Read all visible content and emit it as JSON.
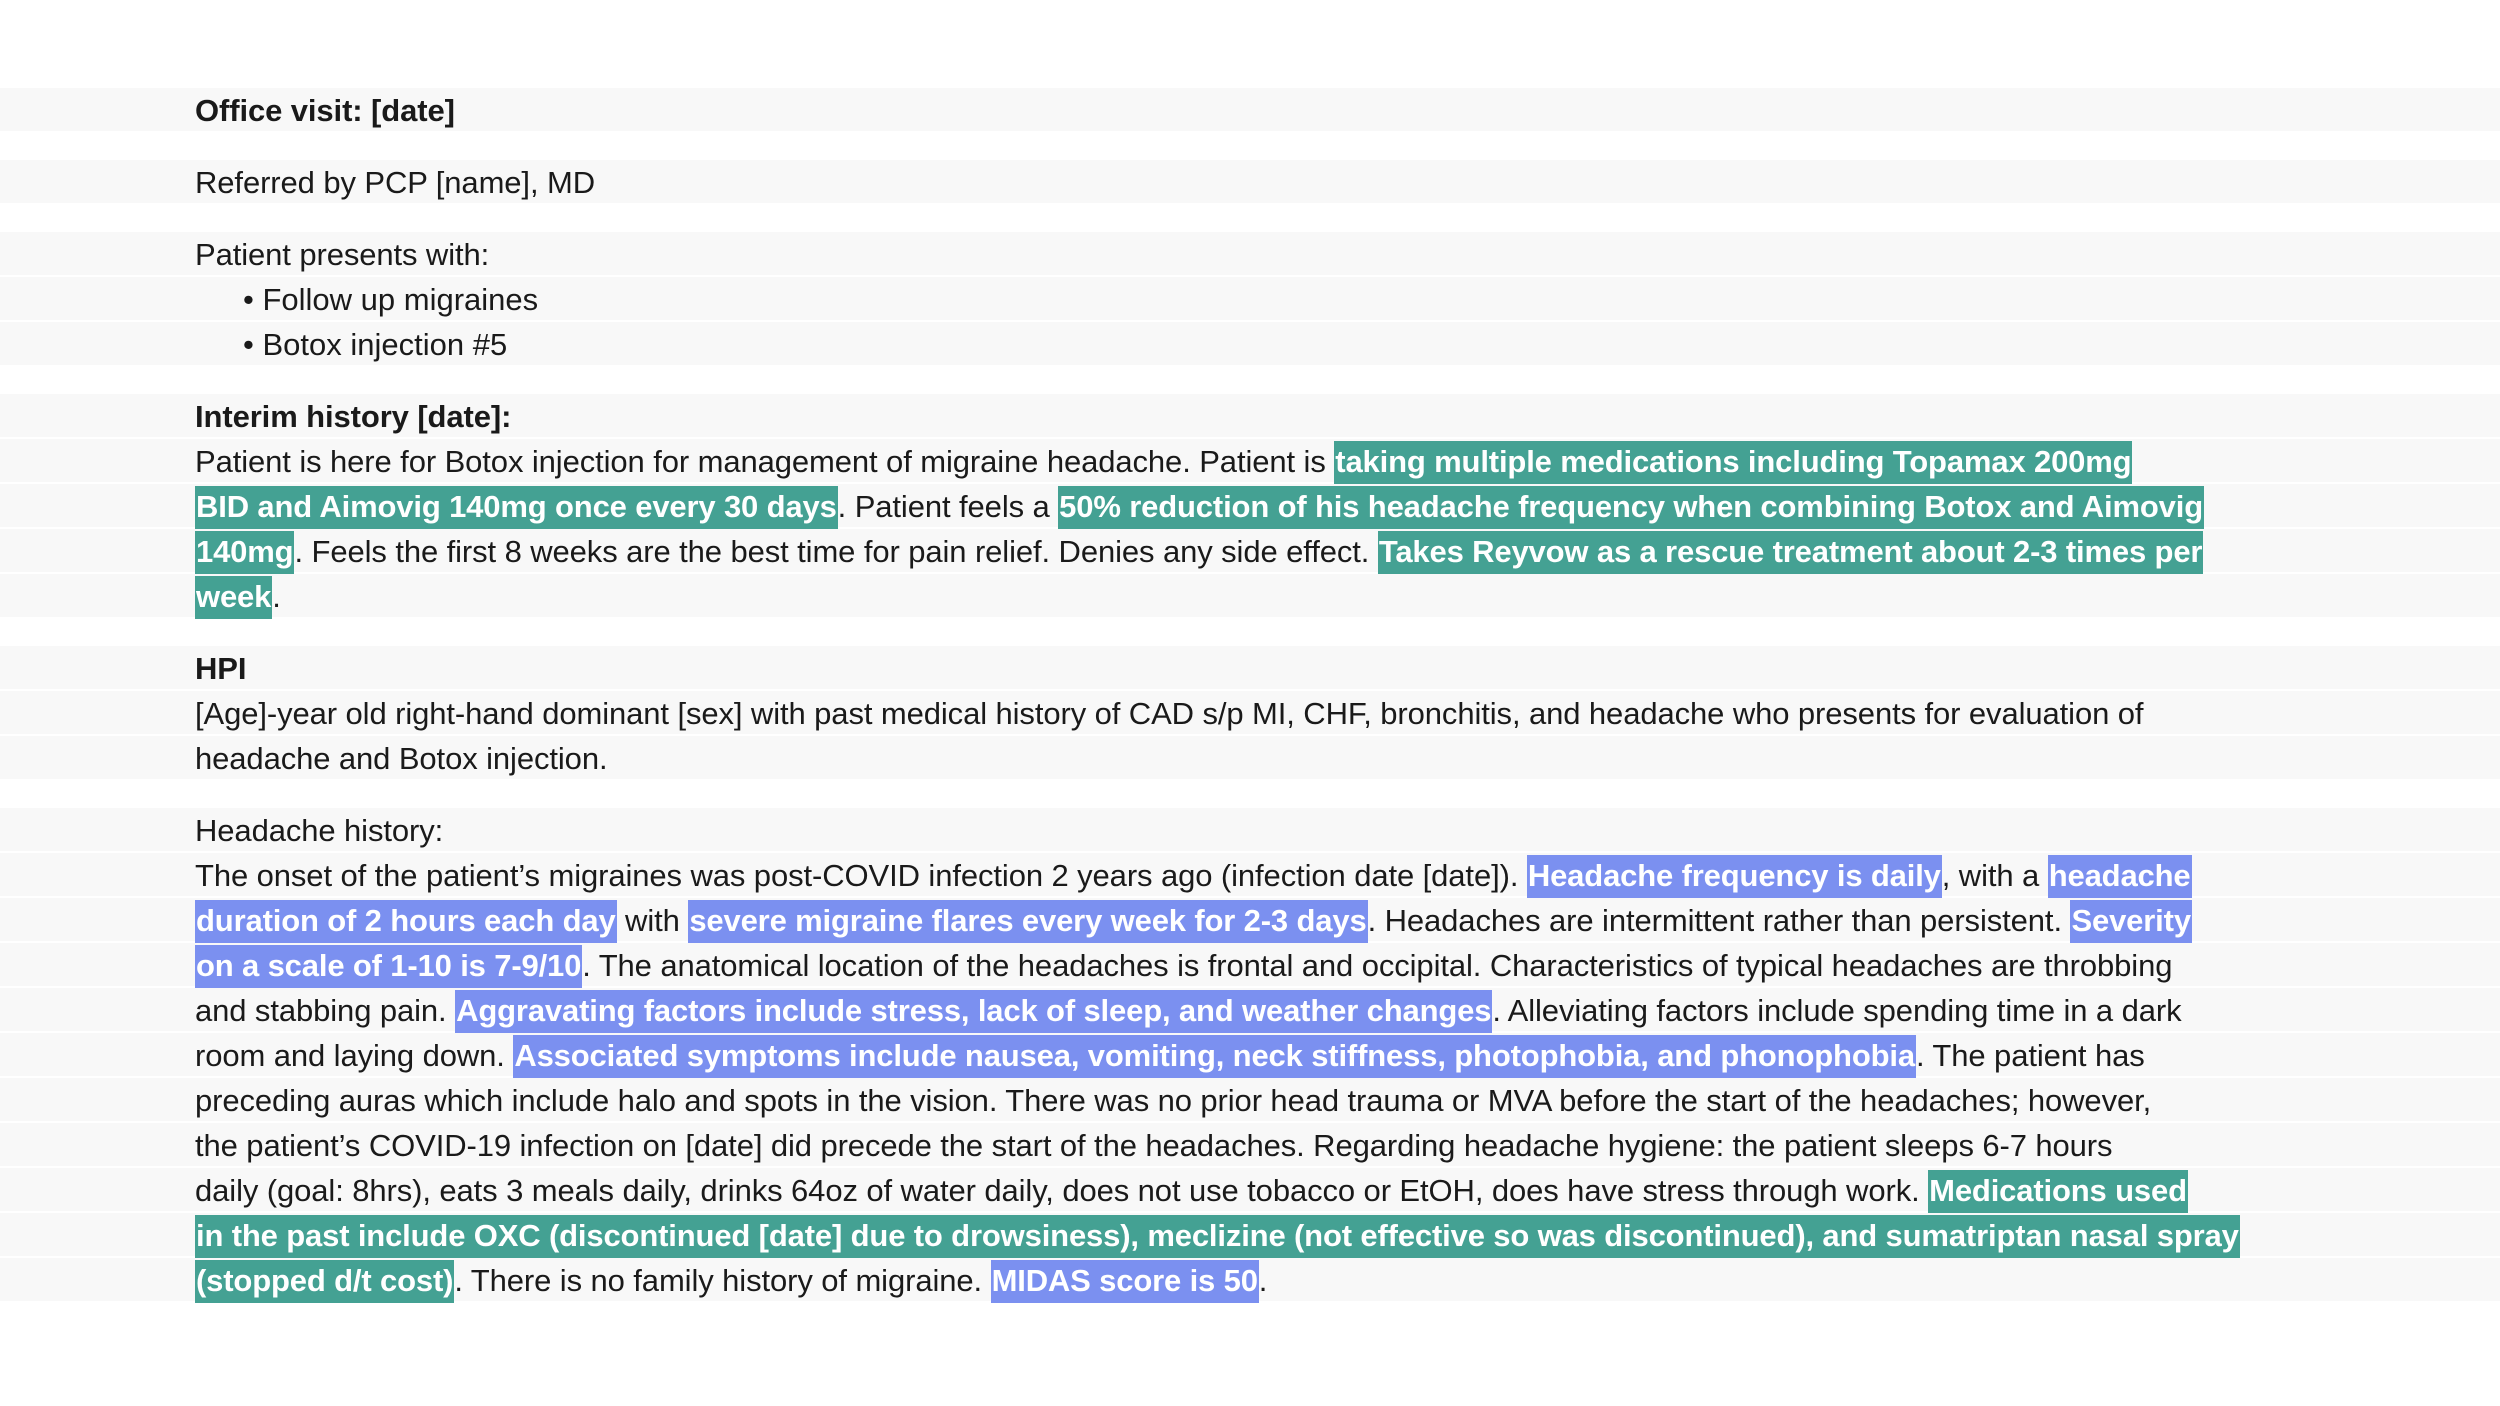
{
  "document": {
    "title": "Office visit: [date]",
    "referral": "Referred by PCP [name], MD",
    "presents_label": "Patient presents with:",
    "bullets": [
      "• Follow up migraines",
      "• Botox injection #5"
    ],
    "interim_heading": "Interim history [date]:",
    "hpi_heading": "HPI",
    "headache_history_label": "Headache history:"
  },
  "colors": {
    "highlight_teal": "#44a193",
    "highlight_blue": "#7b90f0",
    "line_band": "#f8f8f8",
    "page_background": "#ffffff",
    "text": "#1a1a1a"
  },
  "interim_history": {
    "l1_a": "Patient is here for Botox injection for management of migraine headache. Patient is ",
    "l1_hl": "taking multiple medications including Topamax 200mg",
    "l2_hl_a": "BID and Aimovig 140mg once every 30 days",
    "l2_b": ". Patient feels a ",
    "l2_hl_b": "50% reduction of his headache frequency when combining Botox and Aimovig",
    "l3_hl_a": "140mg",
    "l3_b": ". Feels the first 8 weeks are the best time for pain relief. Denies any side effect. ",
    "l3_hl_b": "Takes Reyvow as a rescue treatment about 2-3 times per",
    "l4_hl": "week",
    "l4_b": "."
  },
  "hpi": {
    "l1": "[Age]-year old right-hand dominant [sex] with past medical history of CAD s/p MI, CHF, bronchitis, and headache who presents for evaluation of",
    "l2": "headache and Botox injection."
  },
  "headache_history": {
    "l1_a": "The onset of the patient’s migraines was post-COVID infection 2 years ago (infection date [date]). ",
    "l1_hl_a": "Headache frequency is daily",
    "l1_b": ", with a ",
    "l1_hl_b": "headache",
    "l2_hl_a": "duration of 2 hours each day",
    "l2_b": " with ",
    "l2_hl_b": "severe migraine flares every week for 2-3 days",
    "l2_c": ". Headaches are intermittent rather than persistent. ",
    "l2_hl_c": "Severity",
    "l3_hl_a": "on a scale of 1-10 is 7-9/10",
    "l3_b": ". The anatomical location of the headaches is frontal and occipital. Characteristics of typical headaches are throbbing",
    "l4_a": "and stabbing pain. ",
    "l4_hl": "Aggravating factors include stress, lack of sleep, and weather changes",
    "l4_b": ". Alleviating factors include spending time in a dark",
    "l5_a": "room and laying down. ",
    "l5_hl": "Associated symptoms include nausea, vomiting, neck stiffness, photophobia, and phonophobia",
    "l5_b": ". The patient has",
    "l6": "preceding auras which include halo and spots in the vision. There was no prior head trauma or MVA before the start of the headaches; however,",
    "l7": "the patient’s COVID-19 infection on [date] did precede the start of the headaches. Regarding headache hygiene: the patient sleeps 6-7 hours",
    "l8_a": "daily (goal: 8hrs), eats 3 meals daily, drinks 64oz of water daily, does not use tobacco or EtOH, does have stress through work. ",
    "l8_hl": "Medications used",
    "l9_hl": "in the past include OXC (discontinued [date] due to drowsiness), meclizine (not effective so was discontinued), and sumatriptan nasal spray",
    "l10_hl_a": "(stopped d/t cost)",
    "l10_b": ". There is no family history of migraine. ",
    "l10_hl_b": "MIDAS score is 50",
    "l10_c": "."
  }
}
